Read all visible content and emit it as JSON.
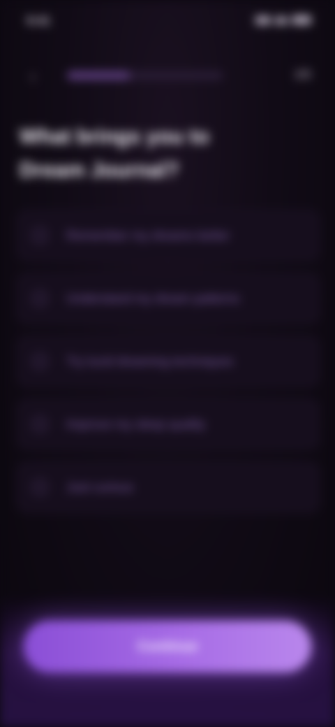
{
  "status_bar": {
    "time": "9:41"
  },
  "header": {
    "back_icon": "chevron-left-icon",
    "step": "2/5",
    "progress": 0.4
  },
  "question": "What brings you to Dream Journal?",
  "options": [
    {
      "label": "Remember my dreams better"
    },
    {
      "label": "Understand my dream patterns"
    },
    {
      "label": "Try lucid dreaming techniques"
    },
    {
      "label": "Improve my sleep quality"
    },
    {
      "label": "Just curious"
    }
  ],
  "footer": {
    "continue_label": "Continue"
  },
  "colors": {
    "accent": "#9b5de5",
    "background": "#0c0810"
  }
}
